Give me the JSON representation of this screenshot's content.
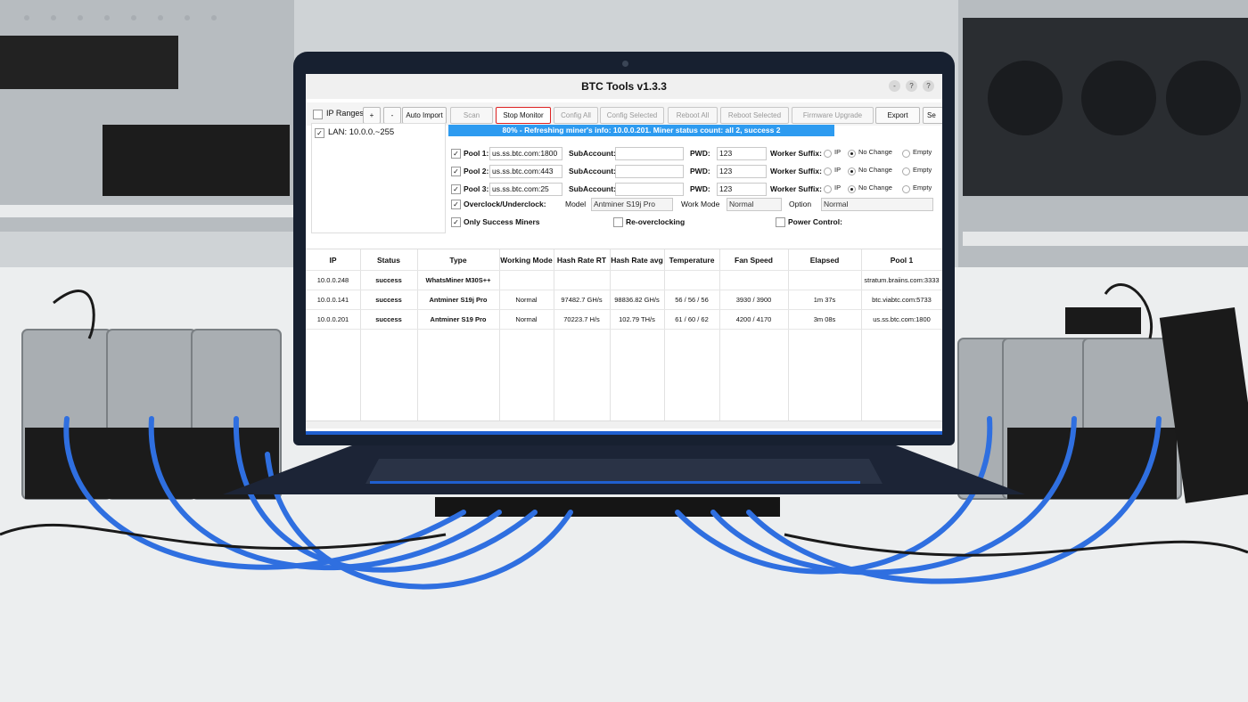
{
  "window": {
    "title": "BTC Tools v1.3.3",
    "buttons": [
      "-",
      "?",
      "?"
    ]
  },
  "toolbar": {
    "ip_ranges_label": "IP Ranges",
    "plus": "+",
    "minus": "-",
    "auto_import": "Auto Import",
    "scan": "Scan",
    "stop_monitor": "Stop Monitor",
    "config_all": "Config All",
    "config_selected": "Config Selected",
    "reboot_all": "Reboot All",
    "reboot_selected": "Reboot Selected",
    "firmware_upgrade": "Firmware Upgrade",
    "export": "Export",
    "se": "Se"
  },
  "lan": {
    "label": "LAN: 10.0.0.~255"
  },
  "progress": {
    "text": "80% - Refreshing miner's info: 10.0.0.201. Miner status count: all 2, success 2",
    "fraction": 0.8
  },
  "pools": [
    {
      "label": "Pool 1:",
      "url": "us.ss.btc.com:1800",
      "subaccount_label": "SubAccount:",
      "subaccount": "",
      "pwd_label": "PWD:",
      "pwd": "123",
      "suffix_label": "Worker Suffix:"
    },
    {
      "label": "Pool 2:",
      "url": "us.ss.btc.com:443",
      "subaccount_label": "SubAccount:",
      "subaccount": "",
      "pwd_label": "PWD:",
      "pwd": "123",
      "suffix_label": "Worker Suffix:"
    },
    {
      "label": "Pool 3:",
      "url": "us.ss.btc.com:25",
      "subaccount_label": "SubAccount:",
      "subaccount": "",
      "pwd_label": "PWD:",
      "pwd": "123",
      "suffix_label": "Worker Suffix:"
    }
  ],
  "suffix_options": {
    "ip": "IP",
    "no_change": "No Change",
    "empty": "Empty"
  },
  "overclock": {
    "label": "Overclock/Underclock:",
    "model_label": "Model",
    "model": "Antminer S19j Pro",
    "work_mode_label": "Work Mode",
    "work_mode": "Normal",
    "option_label": "Option",
    "option": "Normal"
  },
  "filters": {
    "only_success": "Only Success Miners",
    "re_overclocking": "Re-overclocking",
    "power_control": "Power Control:"
  },
  "table": {
    "columns": [
      "IP",
      "Status",
      "Type",
      "Working Mode",
      "Hash Rate RT",
      "Hash Rate avg",
      "Temperature",
      "Fan Speed",
      "Elapsed",
      "Pool 1"
    ],
    "rows": [
      [
        "10.0.0.248",
        "success",
        "WhatsMiner M30S++",
        "",
        "",
        "",
        "",
        "",
        "",
        "stratum.braiins.com:3333"
      ],
      [
        "10.0.0.141",
        "success",
        "Antminer S19j Pro",
        "Normal",
        "97482.7 GH/s",
        "98836.82 GH/s",
        "56 / 56 / 56",
        "3930 / 3900",
        "1m 37s",
        "btc.viabtc.com:5733"
      ],
      [
        "10.0.0.201",
        "success",
        "Antminer S19 Pro",
        "Normal",
        "70223.7 H/s",
        "102.79 TH/s",
        "61 / 60 / 62",
        "4200 / 4170",
        "3m 08s",
        "us.ss.btc.com:1800"
      ]
    ]
  }
}
